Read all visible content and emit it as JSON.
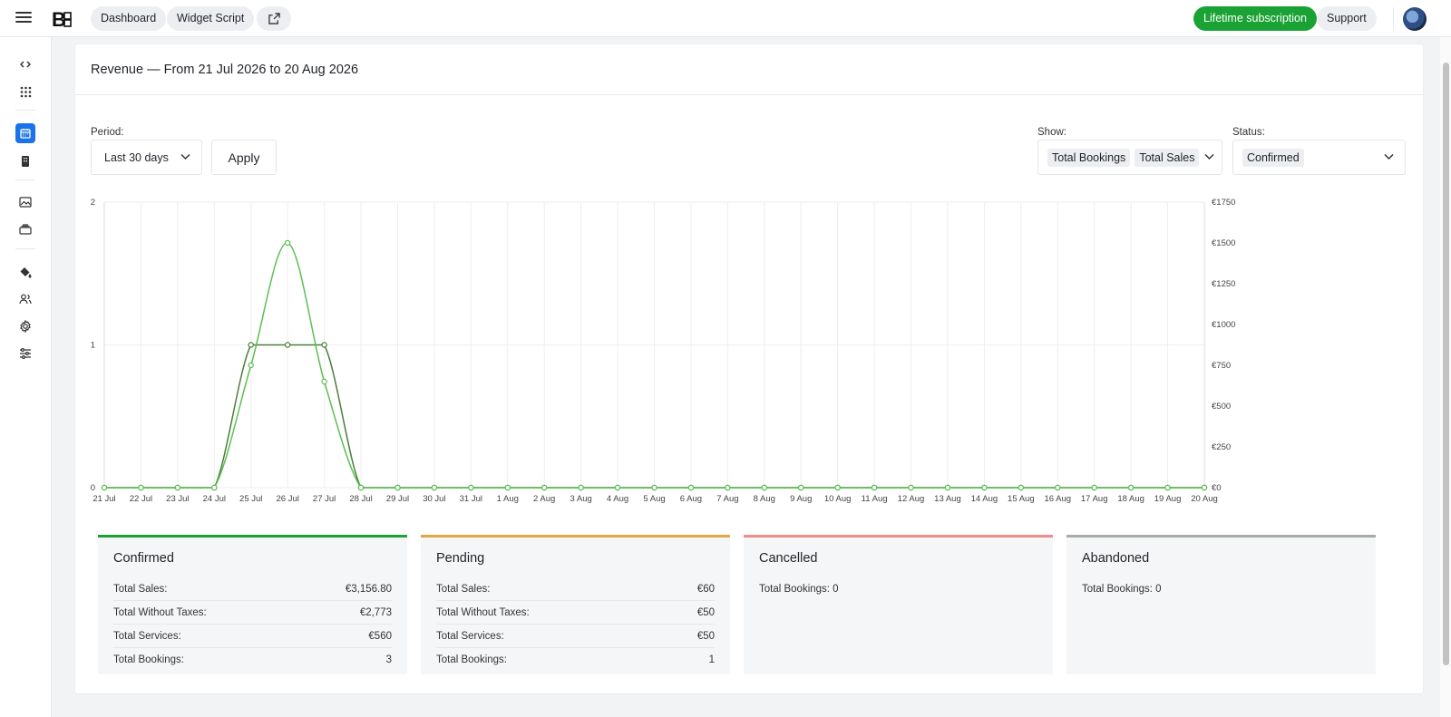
{
  "topbar": {
    "brand": "B",
    "nav": [
      {
        "label": "Dashboard"
      },
      {
        "label": "Widget Script"
      }
    ],
    "open_external_icon": "external-link-icon",
    "subscription_label": "Lifetime subscription",
    "support_label": "Support"
  },
  "sidebar": {
    "items": [
      {
        "icon": "code-icon"
      },
      {
        "icon": "apps-grid-icon"
      },
      {
        "icon": "calendar-icon",
        "active": true
      },
      {
        "icon": "building-icon"
      },
      {
        "icon": "image-icon"
      },
      {
        "icon": "card-stack-icon"
      },
      {
        "icon": "paint-bucket-icon"
      },
      {
        "icon": "users-icon"
      },
      {
        "icon": "gear-icon"
      },
      {
        "icon": "sliders-icon"
      }
    ]
  },
  "report": {
    "title": "Revenue — From 21 Jul 2026 to 20 Aug 2026",
    "period_label": "Period:",
    "period_value": "Last 30 days",
    "apply_label": "Apply",
    "show_label": "Show:",
    "show_values": [
      "Total Bookings",
      "Total Sales"
    ],
    "status_label": "Status:",
    "status_value": "Confirmed"
  },
  "chart_data": {
    "type": "line",
    "categories": [
      "21 Jul",
      "22 Jul",
      "23 Jul",
      "24 Jul",
      "25 Jul",
      "26 Jul",
      "27 Jul",
      "28 Jul",
      "29 Jul",
      "30 Jul",
      "31 Jul",
      "1 Aug",
      "2 Aug",
      "3 Aug",
      "4 Aug",
      "5 Aug",
      "6 Aug",
      "7 Aug",
      "8 Aug",
      "9 Aug",
      "10 Aug",
      "11 Aug",
      "12 Aug",
      "13 Aug",
      "14 Aug",
      "15 Aug",
      "16 Aug",
      "17 Aug",
      "18 Aug",
      "19 Aug",
      "20 Aug"
    ],
    "y_left": {
      "ticks": [
        "0",
        "1",
        "2"
      ],
      "ylim": [
        0,
        2
      ]
    },
    "y_right": {
      "ticks": [
        "€0",
        "€250",
        "€500",
        "€750",
        "€1000",
        "€1250",
        "€1500",
        "€1750"
      ],
      "ylim": [
        0,
        1750
      ]
    },
    "series": [
      {
        "axis": "left",
        "color": "#4a7d3a",
        "values": [
          0,
          0,
          0,
          0,
          1,
          1,
          1,
          0,
          0,
          0,
          0,
          0,
          0,
          0,
          0,
          0,
          0,
          0,
          0,
          0,
          0,
          0,
          0,
          0,
          0,
          0,
          0,
          0,
          0,
          0,
          0
        ]
      },
      {
        "axis": "right",
        "color": "#5cbf52",
        "values": [
          0,
          0,
          0,
          0,
          750,
          1500,
          650,
          0,
          0,
          0,
          0,
          0,
          0,
          0,
          0,
          0,
          0,
          0,
          0,
          0,
          0,
          0,
          0,
          0,
          0,
          0,
          0,
          0,
          0,
          0,
          0
        ]
      }
    ],
    "grid": true
  },
  "summary": [
    {
      "title": "Confirmed",
      "color": "#1aa235",
      "rows": [
        {
          "label": "Total Sales:",
          "value": "€3,156.80"
        },
        {
          "label": "Total Without Taxes:",
          "value": "€2,773"
        },
        {
          "label": "Total Services:",
          "value": "€560"
        },
        {
          "label": "Total Bookings:",
          "value": "3"
        }
      ]
    },
    {
      "title": "Pending",
      "color": "#e2a744",
      "rows": [
        {
          "label": "Total Sales:",
          "value": "€60"
        },
        {
          "label": "Total Without Taxes:",
          "value": "€50"
        },
        {
          "label": "Total Services:",
          "value": "€50"
        },
        {
          "label": "Total Bookings:",
          "value": "1"
        }
      ]
    },
    {
      "title": "Cancelled",
      "color": "#ef8a8a",
      "rows": [
        {
          "label": "Total Bookings: 0",
          "value": ""
        }
      ]
    },
    {
      "title": "Abandoned",
      "color": "#a9aaa8",
      "rows": [
        {
          "label": "Total Bookings: 0",
          "value": ""
        }
      ]
    }
  ]
}
